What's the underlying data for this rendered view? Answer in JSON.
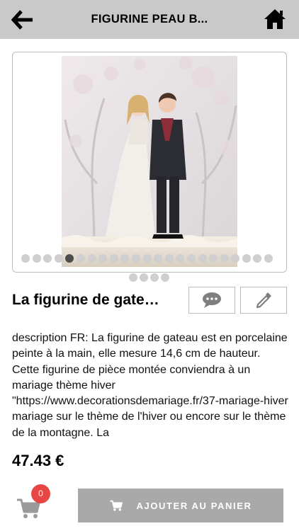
{
  "header": {
    "title": "FIGURINE PEAU B...",
    "back_icon": "arrow-left-icon",
    "home_icon": "home-icon"
  },
  "gallery": {
    "slide_count": 23,
    "active_index": 4,
    "thumb_count": 4
  },
  "product": {
    "title": "La figurine de gate…",
    "description": "description FR: La figurine de gateau est en porcelaine peinte à la main, elle mesure 14,6 cm de hauteur. Cette figurine de pièce montée conviendra à un mariage thème hiver \"https://www.decorationsdemariage.fr/37-mariage-hiver mariage sur le thème de l'hiver ou encore sur le thème de la montagne.  La",
    "price": "47.43 €"
  },
  "actions": {
    "comment_icon": "comment-icon",
    "edit_icon": "pencil-icon"
  },
  "cart": {
    "count": "0",
    "add_label": "AJOUTER AU PANIER"
  },
  "colors": {
    "header_bg": "#c9c9c9",
    "badge": "#e84545",
    "button_bg": "#a9a9a9"
  }
}
